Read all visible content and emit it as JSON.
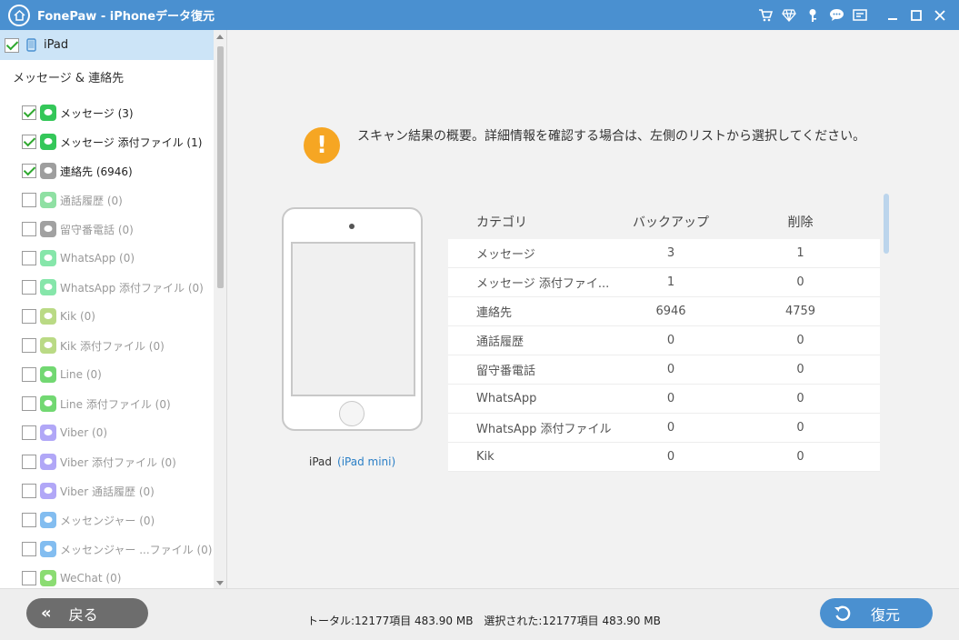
{
  "window": {
    "title": "FonePaw - iPhoneデータ復元",
    "icons": [
      "cart-icon",
      "diamond-icon",
      "key-icon",
      "chat-icon",
      "feedback-icon",
      "minimize-icon",
      "maximize-icon",
      "close-icon"
    ]
  },
  "sidebar": {
    "device": {
      "label": "iPad",
      "checked": true
    },
    "section_title": "メッセージ & 連絡先",
    "items": [
      {
        "label": "メッセージ (3)",
        "checked": true,
        "active": true,
        "icon": "messages-icon",
        "color": "#34c759"
      },
      {
        "label": "メッセージ 添付ファイル (1)",
        "checked": true,
        "active": true,
        "icon": "message-attachments-icon",
        "color": "#34c759"
      },
      {
        "label": "連絡先 (6946)",
        "checked": true,
        "active": true,
        "icon": "contacts-icon",
        "color": "#9e9e9e"
      },
      {
        "label": "通話履歴 (0)",
        "checked": false,
        "active": false,
        "icon": "phone-icon",
        "color": "#34c759"
      },
      {
        "label": "留守番電話 (0)",
        "checked": false,
        "active": false,
        "icon": "voicemail-icon",
        "color": "#555555"
      },
      {
        "label": "WhatsApp (0)",
        "checked": false,
        "active": false,
        "icon": "whatsapp-icon",
        "color": "#25d366"
      },
      {
        "label": "WhatsApp 添付ファイル (0)",
        "checked": false,
        "active": false,
        "icon": "whatsapp-attachments-icon",
        "color": "#25d366"
      },
      {
        "label": "Kik (0)",
        "checked": false,
        "active": false,
        "icon": "kik-icon",
        "color": "#82bc23"
      },
      {
        "label": "Kik 添付ファイル (0)",
        "checked": false,
        "active": false,
        "icon": "kik-attachments-icon",
        "color": "#82bc23"
      },
      {
        "label": "Line (0)",
        "checked": false,
        "active": false,
        "icon": "line-icon",
        "color": "#00b900"
      },
      {
        "label": "Line 添付ファイル (0)",
        "checked": false,
        "active": false,
        "icon": "line-attachments-icon",
        "color": "#00b900"
      },
      {
        "label": "Viber (0)",
        "checked": false,
        "active": false,
        "icon": "viber-icon",
        "color": "#7360f2"
      },
      {
        "label": "Viber 添付ファイル (0)",
        "checked": false,
        "active": false,
        "icon": "viber-attachments-icon",
        "color": "#7360f2"
      },
      {
        "label": "Viber 通話履歴 (0)",
        "checked": false,
        "active": false,
        "icon": "viber-calls-icon",
        "color": "#7360f2"
      },
      {
        "label": "メッセンジャー (0)",
        "checked": false,
        "active": false,
        "icon": "messenger-icon",
        "color": "#1e88e5"
      },
      {
        "label": "メッセンジャー ...ファイル (0)",
        "checked": false,
        "active": false,
        "icon": "messenger-attachments-icon",
        "color": "#1e88e5"
      },
      {
        "label": "WeChat (0)",
        "checked": false,
        "active": false,
        "icon": "wechat-icon",
        "color": "#2dc100"
      }
    ]
  },
  "main": {
    "summary": "スキャン結果の概要。詳細情報を確認する場合は、左側のリストから選択してください。",
    "device_name": "iPad",
    "device_model": "(iPad mini)",
    "table": {
      "headers": [
        "カテゴリ",
        "バックアップ",
        "削除"
      ],
      "rows": [
        [
          "メッセージ",
          "3",
          "1"
        ],
        [
          "メッセージ 添付ファイ...",
          "1",
          "0"
        ],
        [
          "連絡先",
          "6946",
          "4759"
        ],
        [
          "通話履歴",
          "0",
          "0"
        ],
        [
          "留守番電話",
          "0",
          "0"
        ],
        [
          "WhatsApp",
          "0",
          "0"
        ],
        [
          "WhatsApp 添付ファイル",
          "0",
          "0"
        ],
        [
          "Kik",
          "0",
          "0"
        ]
      ]
    }
  },
  "footer": {
    "back_label": "戻る",
    "total": "トータル:12177項目 483.90 MB",
    "selected": "選択された:12177項目 483.90 MB",
    "recover_label": "復元"
  },
  "colors": {
    "titlebar": "#4a90d0",
    "selected_row": "#cce4f7",
    "alert": "#f6a623",
    "link": "#2b7fc6",
    "back_button": "#6d6d6d",
    "recover_button": "#4a90d0"
  }
}
